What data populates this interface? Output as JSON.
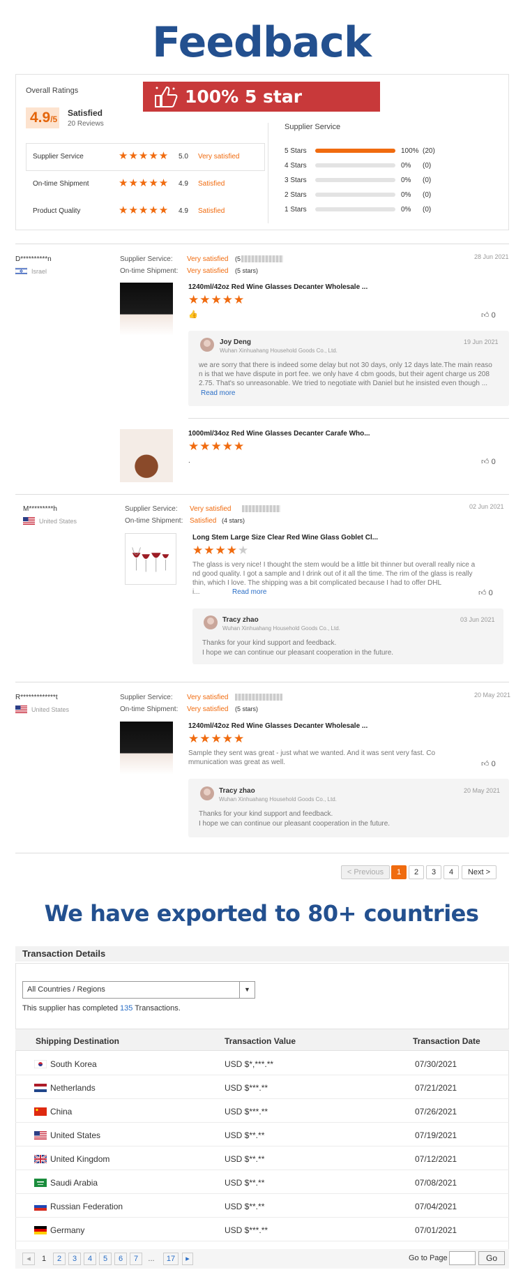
{
  "header_title": "Feedback",
  "banner": "100% 5 star reviews",
  "ratings": {
    "heading": "Overall Ratings",
    "score": "4.9",
    "score_suffix": "/5",
    "label": "Satisfied",
    "count": "20 Reviews",
    "rows": [
      {
        "name": "Supplier Service",
        "value": "5.0",
        "status": "Very satisfied"
      },
      {
        "name": "On-time Shipment",
        "value": "4.9",
        "status": "Satisfied"
      },
      {
        "name": "Product Quality",
        "value": "4.9",
        "status": "Satisfied"
      }
    ],
    "supplier_heading": "Supplier Service",
    "distribution": [
      {
        "label": "5 Stars",
        "pct": "100%",
        "count": "(20)",
        "fill": 1.0
      },
      {
        "label": "4 Stars",
        "pct": "0%",
        "count": "(0)",
        "fill": 0
      },
      {
        "label": "3 Stars",
        "pct": "0%",
        "count": "(0)",
        "fill": 0
      },
      {
        "label": "2 Stars",
        "pct": "0%",
        "count": "(0)",
        "fill": 0
      },
      {
        "label": "1 Stars",
        "pct": "0%",
        "count": "(0)",
        "fill": 0
      }
    ]
  },
  "reviews": [
    {
      "user": "D**********n",
      "country": "Israel",
      "date": "28 Jun 2021",
      "ss_label": "Supplier Service:",
      "ss_value": "Very satisfied",
      "ss_extra": "(5",
      "os_label": "On-time Shipment:",
      "os_value": "Very satisfied",
      "os_extra": "(5 stars)",
      "products": [
        {
          "title": "1240ml/42oz Red Wine Glasses Decanter Wholesale ...",
          "likes": "0",
          "text": "👍",
          "reply": {
            "name": "Joy Deng",
            "company": "Wuhan Xinhuahang Household Goods Co., Ltd.",
            "date": "19 Jun 2021",
            "line1": "we are sorry that there is indeed some delay but not 30 days, only 12 days late.The main reaso",
            "line2": "n is that we have dispute in port fee. we only have 4 cbm goods, but their agent charge us 208",
            "line3": "2.75. That's so unreasonable. We tried to negotiate with Daniel but he insisted even though ...",
            "more": "Read more"
          }
        },
        {
          "title": "1000ml/34oz Red Wine Glasses Decanter Carafe Who...",
          "likes": "0",
          "text": "."
        }
      ]
    },
    {
      "user": "M*********h",
      "country": "United States",
      "date": "02 Jun 2021",
      "ss_label": "Supplier Service:",
      "ss_value": "Very satisfied",
      "os_label": "On-time Shipment:",
      "os_value": "Satisfied",
      "os_extra": "(4 stars)",
      "product": {
        "title": "Long Stem Large Size Clear Red Wine Glass Goblet Cl...",
        "likes": "0",
        "line1": "The glass is very nice! I thought the stem would be a little bit thinner but overall really nice a",
        "line2": "nd good quality. I got a sample and I drink out of it all the time. The rim of the glass is really",
        "line3": "thin, which I love. The shipping was a bit complicated because I had to offer DHL",
        "line4": "i...",
        "more": "Read more"
      },
      "reply": {
        "name": "Tracy zhao",
        "company": "Wuhan Xinhuahang Household Goods Co., Ltd.",
        "date": "03 Jun 2021",
        "line1": "Thanks for your kind support and feedback.",
        "line2": "I hope we can continue our pleasant cooperation in the future."
      }
    },
    {
      "user": "R*************t",
      "country": "United States",
      "date": "20 May 2021",
      "ss_label": "Supplier Service:",
      "ss_value": "Very satisfied",
      "os_label": "On-time Shipment:",
      "os_value": "Very satisfied",
      "os_extra": "(5 stars)",
      "product": {
        "title": "1240ml/42oz Red Wine Glasses Decanter Wholesale ...",
        "likes": "0",
        "line1": "Sample they sent was great - just what we wanted.  And it was sent very fast.  Co",
        "line2": "mmunication was great as well."
      },
      "reply": {
        "name": "Tracy zhao",
        "company": "Wuhan Xinhuahang Household Goods Co., Ltd.",
        "date": "20 May 2021",
        "line1": "Thanks for your kind support and feedback.",
        "line2": "I hope we can continue our pleasant cooperation in the future."
      }
    }
  ],
  "pagination": {
    "prev": "< Previous",
    "pages": [
      "1",
      "2",
      "3",
      "4"
    ],
    "next": "Next >"
  },
  "export_title": "We have exported to 80+ countries",
  "transactions": {
    "heading": "Transaction Details",
    "select": "All Countries / Regions",
    "summary_pre": "This supplier has completed ",
    "summary_count": "135",
    "summary_post": " Transactions.",
    "columns": [
      "Shipping Destination",
      "Transaction Value",
      "Transaction Date"
    ],
    "rows": [
      {
        "country": "South Korea",
        "value": "USD $*,***.**",
        "date": "07/30/2021"
      },
      {
        "country": "Netherlands",
        "value": "USD $***.**",
        "date": "07/21/2021"
      },
      {
        "country": "China",
        "value": "USD $***.**",
        "date": "07/26/2021"
      },
      {
        "country": "United States",
        "value": "USD $**.**",
        "date": "07/19/2021"
      },
      {
        "country": "United Kingdom",
        "value": "USD $**.**",
        "date": "07/12/2021"
      },
      {
        "country": "Saudi Arabia",
        "value": "USD $**.**",
        "date": "07/08/2021"
      },
      {
        "country": "Russian Federation",
        "value": "USD $**.**",
        "date": "07/04/2021"
      },
      {
        "country": "Germany",
        "value": "USD $***.**",
        "date": "07/01/2021"
      }
    ],
    "pages": [
      "1",
      "2",
      "3",
      "4",
      "5",
      "6",
      "7",
      "...",
      "17"
    ],
    "goto_label": "Go to Page",
    "go": "Go"
  },
  "colors": {
    "accent": "#f06b0f",
    "title_blue": "#23508f",
    "banner_red": "#c8393a",
    "link": "#2a6ec6"
  }
}
